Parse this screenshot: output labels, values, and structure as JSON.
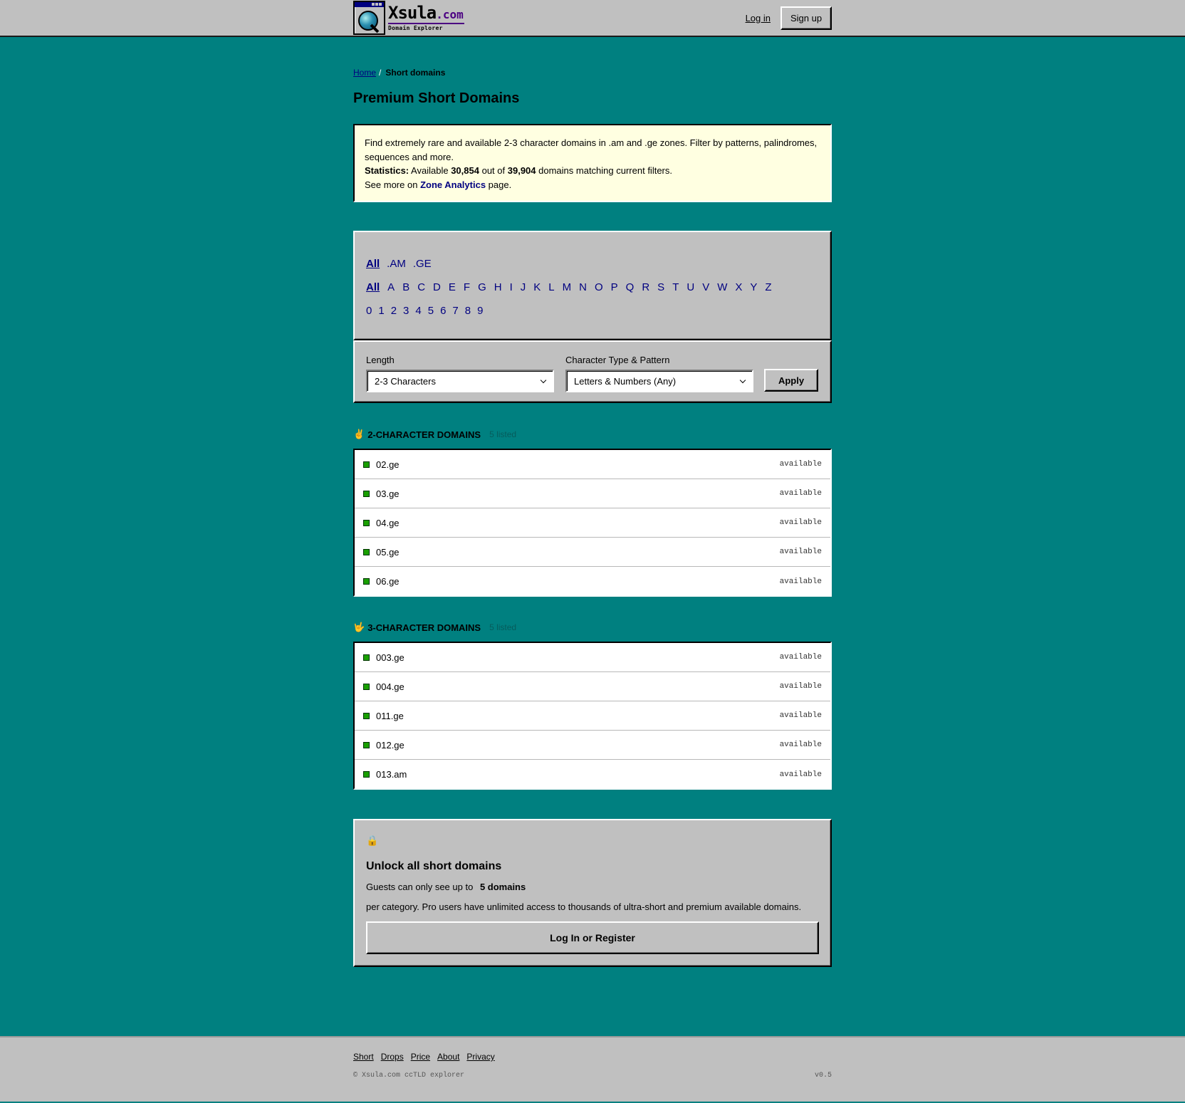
{
  "header": {
    "logo_name": "Xsula",
    "logo_domain": ".com",
    "logo_tagline": "Domain Explorer",
    "login_label": "Log in",
    "signup_label": "Sign up"
  },
  "breadcrumb": {
    "home_label": "Home",
    "separator": "/",
    "current_label": "Short domains"
  },
  "page_title": "Premium Short Domains",
  "info": {
    "description": "Find extremely rare and available 2-3 character domains in .am and .ge zones. Filter by patterns, palindromes, sequences and more.",
    "stats_label": "Statistics:",
    "stats_prefix": "Available",
    "available_count": "30,854",
    "stats_mid": "out of",
    "total_count": "39,904",
    "stats_suffix": "domains matching current filters.",
    "see_more_prefix": "See more on",
    "zone_link_label": "Zone Analytics",
    "see_more_suffix": "page."
  },
  "filters": {
    "zones": [
      "All",
      ".AM",
      ".GE"
    ],
    "active_zone": "All",
    "letters": [
      "All",
      "A",
      "B",
      "C",
      "D",
      "E",
      "F",
      "G",
      "H",
      "I",
      "J",
      "K",
      "L",
      "M",
      "N",
      "O",
      "P",
      "Q",
      "R",
      "S",
      "T",
      "U",
      "V",
      "W",
      "X",
      "Y",
      "Z"
    ],
    "active_letter": "All",
    "digits": [
      "0",
      "1",
      "2",
      "3",
      "4",
      "5",
      "6",
      "7",
      "8",
      "9"
    ]
  },
  "form": {
    "length_label": "Length",
    "length_value": "2-3 Characters",
    "pattern_label": "Character Type & Pattern",
    "pattern_value": "Letters & Numbers (Any)",
    "apply_label": "Apply"
  },
  "sections": [
    {
      "emoji": "✌️",
      "title": "2-character domains",
      "count_label": "5 listed",
      "domains": [
        {
          "name": "02.ge",
          "status": "available"
        },
        {
          "name": "03.ge",
          "status": "available"
        },
        {
          "name": "04.ge",
          "status": "available"
        },
        {
          "name": "05.ge",
          "status": "available"
        },
        {
          "name": "06.ge",
          "status": "available"
        }
      ]
    },
    {
      "emoji": "🤟",
      "title": "3-character domains",
      "count_label": "5 listed",
      "domains": [
        {
          "name": "003.ge",
          "status": "available"
        },
        {
          "name": "004.ge",
          "status": "available"
        },
        {
          "name": "011.ge",
          "status": "available"
        },
        {
          "name": "012.ge",
          "status": "available"
        },
        {
          "name": "013.am",
          "status": "available"
        }
      ]
    }
  ],
  "unlock": {
    "icon": "🔒",
    "title": "Unlock all short domains",
    "guest_text": "Guests can only see up to",
    "limit": "5 domains",
    "pro_text": "per category. Pro users have unlimited access to thousands of ultra-short and premium available domains.",
    "button_label": "Log In or Register"
  },
  "footer": {
    "links": [
      "Short",
      "Drops",
      "Price",
      "About",
      "Privacy"
    ],
    "copyright": "© Xsula.com ccTLD explorer",
    "version": "v0.5"
  },
  "colors": {
    "background": "#008080",
    "panel": "#c0c0c0",
    "info_background": "#ffffe1",
    "link": "#000080",
    "available_indicator": "#1aa000"
  }
}
